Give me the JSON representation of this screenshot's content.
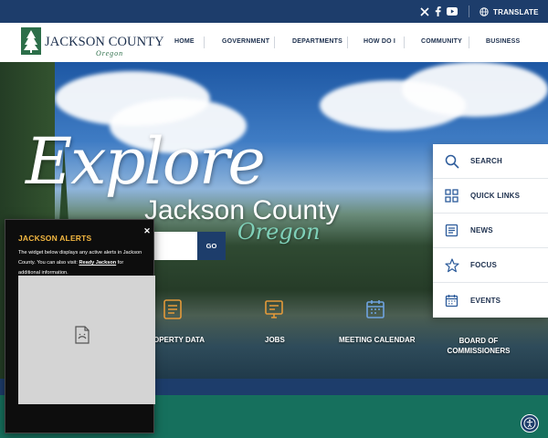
{
  "utility": {
    "translate_label": "TRANSLATE",
    "social": [
      "x-icon",
      "facebook-icon",
      "youtube-icon"
    ]
  },
  "header": {
    "logo_title": "JACKSON COUNTY",
    "logo_subtitle": "Oregon",
    "nav": [
      "HOME",
      "GOVERNMENT",
      "DEPARTMENTS",
      "HOW DO I",
      "COMMUNITY",
      "BUSINESS"
    ]
  },
  "hero": {
    "explore": "Explore",
    "county": "Jackson County",
    "oregon": "Oregon",
    "go_label": "GO",
    "quick_links": [
      {
        "label": "OPERTY DATA",
        "icon": "property-data-icon"
      },
      {
        "label": "JOBS",
        "icon": "jobs-icon"
      },
      {
        "label": "MEETING CALENDAR",
        "icon": "calendar-icon"
      },
      {
        "label": "BOARD OF COMMISSIONERS",
        "icon": "commissioners-icon"
      }
    ]
  },
  "side_panel": [
    {
      "label": "SEARCH",
      "icon": "search-icon"
    },
    {
      "label": "QUICK LINKS",
      "icon": "grid-icon"
    },
    {
      "label": "NEWS",
      "icon": "news-icon"
    },
    {
      "label": "FOCUS",
      "icon": "star-icon"
    },
    {
      "label": "EVENTS",
      "icon": "calendar-icon"
    }
  ],
  "alerts": {
    "title": "JACKSON ALERTS",
    "text_before": "The widget below displays any active alerts in Jackson County. You can also visit: ",
    "link": "Ready Jackson",
    "text_after": " for additional information."
  },
  "colors": {
    "navy": "#1d3d6b",
    "green": "#16705d",
    "alert_title": "#f5b841"
  }
}
